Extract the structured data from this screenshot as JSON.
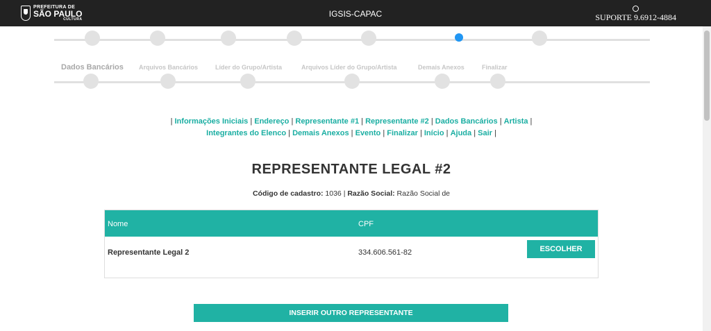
{
  "header": {
    "logo": {
      "line1": "PREFEITURA DE",
      "line2": "SÃO PAULO",
      "line3": "CULTURA"
    },
    "title": "IGSIS-CAPAC",
    "support": "SUPORTE 9.6912-4884",
    "support_icon": "whatsapp-icon"
  },
  "wizard_row1": {
    "steps": [
      {
        "label": "Dados Bancários",
        "emphasis": true
      },
      {
        "label": "Arquivos Bancários"
      },
      {
        "label": "Líder do Grupo/Artista"
      },
      {
        "label": "Arquivos Líder do Grupo/Artista"
      },
      {
        "label": "Demais Anexos"
      },
      {
        "label": "Finalizar"
      }
    ]
  },
  "nav": {
    "line1": [
      "Informações Iniciais",
      "Endereço",
      "Representante #1",
      "Representante #2",
      "Dados Bancários",
      "Artista"
    ],
    "line2": [
      "Integrantes do Elenco",
      "Demais Anexos",
      "Evento",
      "Finalizar",
      "Início",
      "Ajuda",
      "Sair"
    ],
    "separator": "|"
  },
  "page": {
    "heading": "REPRESENTANTE LEGAL #2",
    "code_label": "Código de cadastro:",
    "code_value": "1036",
    "social_label": "Razão Social:",
    "social_value": "Razão Social de"
  },
  "table": {
    "columns": [
      "Nome",
      "CPF"
    ],
    "rows": [
      {
        "nome": "Representante Legal 2",
        "cpf": "334.606.561-82",
        "action": "ESCOLHER"
      }
    ]
  },
  "insert_button": "INSERIR OUTRO REPRESENTANTE",
  "colors": {
    "accent": "#20b2a4",
    "link": "#1aaea2",
    "active_step": "#2196f3",
    "topbar": "#222222"
  }
}
